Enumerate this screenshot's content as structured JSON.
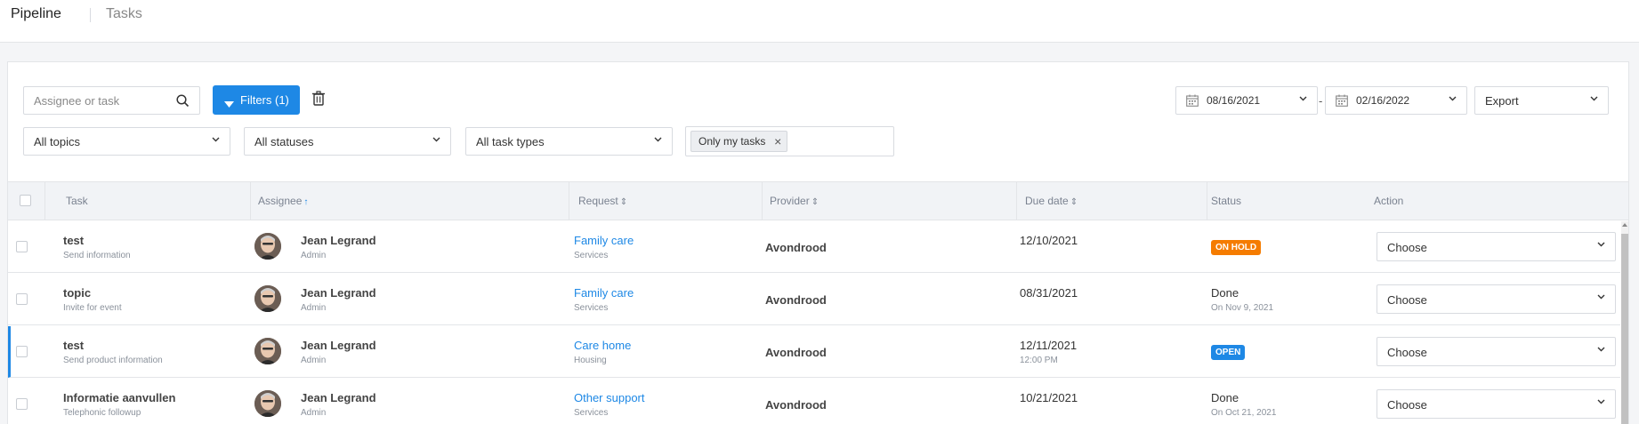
{
  "nav": {
    "pipeline": "Pipeline",
    "tasks": "Tasks"
  },
  "toolbar": {
    "search_placeholder": "Assignee or task",
    "filters_label": "Filters (1)",
    "date_from": "08/16/2021",
    "date_sep": "-",
    "date_to": "02/16/2022",
    "export_label": "Export",
    "topics": "All topics",
    "statuses": "All statuses",
    "task_types": "All task types",
    "chip_only_mine": "Only my tasks",
    "chip_remove": "×"
  },
  "table": {
    "headers": {
      "task": "Task",
      "assignee": "Assignee",
      "request": "Request",
      "provider": "Provider",
      "due": "Due date",
      "status": "Status",
      "action": "Action"
    },
    "sort_up": "↑",
    "sort_both": "⇕",
    "rows": [
      {
        "task": "test",
        "task_sub": "Send information",
        "assignee": "Jean Legrand",
        "role": "Admin",
        "request": "Family care",
        "request_sub": "Services",
        "provider": "Avondrood",
        "due": "12/10/2021",
        "due_sub": "",
        "status": "ON HOLD",
        "status_sub": "",
        "action": "Choose"
      },
      {
        "task": "topic",
        "task_sub": "Invite for event",
        "assignee": "Jean Legrand",
        "role": "Admin",
        "request": "Family care",
        "request_sub": "Services",
        "provider": "Avondrood",
        "due": "08/31/2021",
        "due_sub": "",
        "status": "Done",
        "status_sub": "On Nov 9, 2021",
        "action": "Choose"
      },
      {
        "task": "test",
        "task_sub": "Send product information",
        "assignee": "Jean Legrand",
        "role": "Admin",
        "request": "Care home",
        "request_sub": "Housing",
        "provider": "Avondrood",
        "due": "12/11/2021",
        "due_sub": "12:00 PM",
        "status": "OPEN",
        "status_sub": "",
        "action": "Choose"
      },
      {
        "task": "Informatie aanvullen",
        "task_sub": "Telephonic followup",
        "assignee": "Jean Legrand",
        "role": "Admin",
        "request": "Other support",
        "request_sub": "Services",
        "provider": "Avondrood",
        "due": "10/21/2021",
        "due_sub": "",
        "status": "Done",
        "status_sub": "On Oct 21, 2021",
        "action": "Choose"
      }
    ]
  },
  "colors": {
    "accent": "#1e88e5",
    "on_hold": "#f57c00",
    "open": "#1e88e5"
  }
}
